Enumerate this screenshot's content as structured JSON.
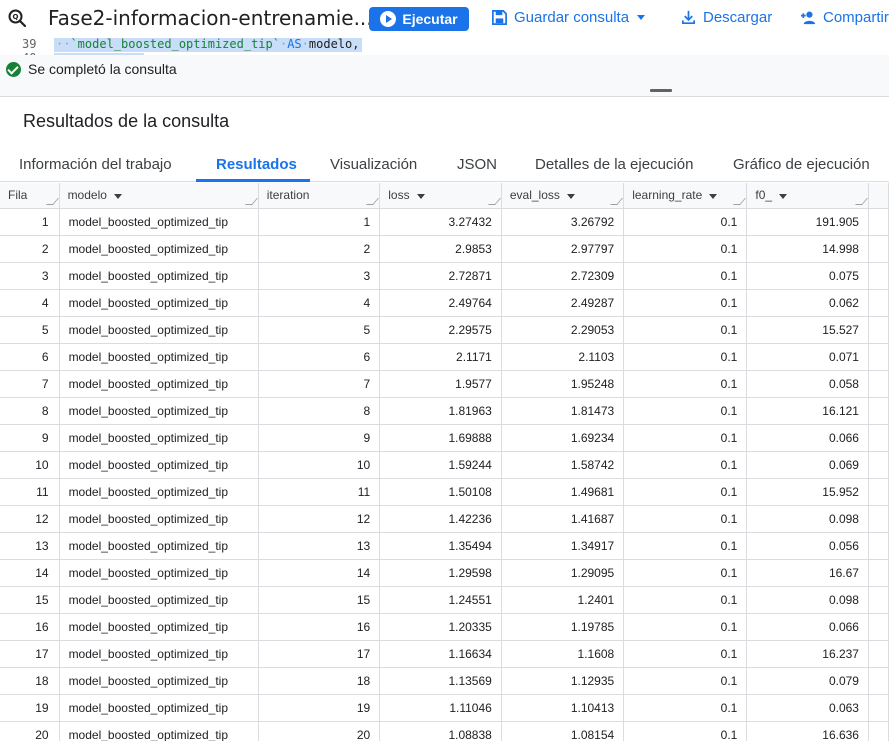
{
  "toolbar": {
    "tab_title": "Fase2-informacion-entrenamie...",
    "run_label": "Ejecutar",
    "save_label": "Guardar consulta",
    "download_label": "Descargar",
    "share_label": "Compartir"
  },
  "editor": {
    "line_number": "39",
    "line_number_next": "40",
    "code_string": "`model_boosted_optimized_tip`",
    "code_keyword": "AS",
    "code_rest": "modelo,"
  },
  "status": {
    "message": "Se completó la consulta"
  },
  "results": {
    "title": "Resultados de la consulta",
    "tabs": [
      {
        "label": "Información del trabajo"
      },
      {
        "label": "Resultados"
      },
      {
        "label": "Visualización"
      },
      {
        "label": "JSON"
      },
      {
        "label": "Detalles de la ejecución"
      },
      {
        "label": "Gráfico de ejecución"
      }
    ],
    "active_tab": "Resultados",
    "columns": [
      "Fila",
      "modelo",
      "iteration",
      "loss",
      "eval_loss",
      "learning_rate",
      "f0_"
    ],
    "rows": [
      [
        "1",
        "model_boosted_optimized_tip",
        "1",
        "3.27432",
        "3.26792",
        "0.1",
        "191.905"
      ],
      [
        "2",
        "model_boosted_optimized_tip",
        "2",
        "2.9853",
        "2.97797",
        "0.1",
        "14.998"
      ],
      [
        "3",
        "model_boosted_optimized_tip",
        "3",
        "2.72871",
        "2.72309",
        "0.1",
        "0.075"
      ],
      [
        "4",
        "model_boosted_optimized_tip",
        "4",
        "2.49764",
        "2.49287",
        "0.1",
        "0.062"
      ],
      [
        "5",
        "model_boosted_optimized_tip",
        "5",
        "2.29575",
        "2.29053",
        "0.1",
        "15.527"
      ],
      [
        "6",
        "model_boosted_optimized_tip",
        "6",
        "2.1171",
        "2.1103",
        "0.1",
        "0.071"
      ],
      [
        "7",
        "model_boosted_optimized_tip",
        "7",
        "1.9577",
        "1.95248",
        "0.1",
        "0.058"
      ],
      [
        "8",
        "model_boosted_optimized_tip",
        "8",
        "1.81963",
        "1.81473",
        "0.1",
        "16.121"
      ],
      [
        "9",
        "model_boosted_optimized_tip",
        "9",
        "1.69888",
        "1.69234",
        "0.1",
        "0.066"
      ],
      [
        "10",
        "model_boosted_optimized_tip",
        "10",
        "1.59244",
        "1.58742",
        "0.1",
        "0.069"
      ],
      [
        "11",
        "model_boosted_optimized_tip",
        "11",
        "1.50108",
        "1.49681",
        "0.1",
        "15.952"
      ],
      [
        "12",
        "model_boosted_optimized_tip",
        "12",
        "1.42236",
        "1.41687",
        "0.1",
        "0.098"
      ],
      [
        "13",
        "model_boosted_optimized_tip",
        "13",
        "1.35494",
        "1.34917",
        "0.1",
        "0.056"
      ],
      [
        "14",
        "model_boosted_optimized_tip",
        "14",
        "1.29598",
        "1.29095",
        "0.1",
        "16.67"
      ],
      [
        "15",
        "model_boosted_optimized_tip",
        "15",
        "1.24551",
        "1.2401",
        "0.1",
        "0.098"
      ],
      [
        "16",
        "model_boosted_optimized_tip",
        "16",
        "1.20335",
        "1.19785",
        "0.1",
        "0.066"
      ],
      [
        "17",
        "model_boosted_optimized_tip",
        "17",
        "1.16634",
        "1.1608",
        "0.1",
        "16.237"
      ],
      [
        "18",
        "model_boosted_optimized_tip",
        "18",
        "1.13569",
        "1.12935",
        "0.1",
        "0.079"
      ],
      [
        "19",
        "model_boosted_optimized_tip",
        "19",
        "1.11046",
        "1.10413",
        "0.1",
        "0.063"
      ],
      [
        "20",
        "model_boosted_optimized_tip",
        "20",
        "1.08838",
        "1.08154",
        "0.1",
        "16.636"
      ]
    ]
  },
  "icons": {
    "query": "query-icon",
    "run": "play-icon",
    "save": "save-icon",
    "download": "download-icon",
    "share": "person-add-icon",
    "status": "check-circle-icon"
  },
  "colors": {
    "accent": "#1a73e8",
    "success": "#188038"
  }
}
